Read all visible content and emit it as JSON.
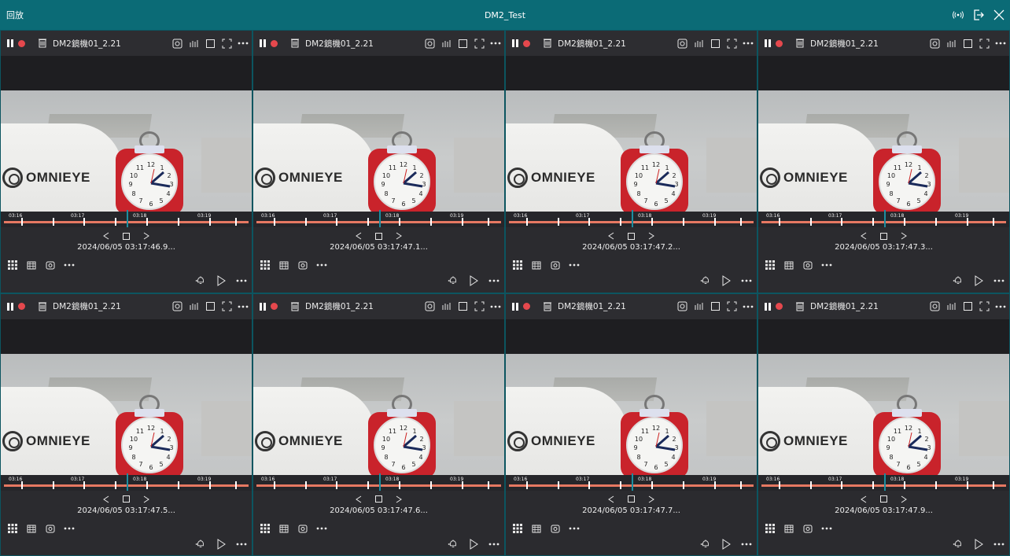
{
  "titlebar": {
    "app_title": "回放",
    "window_title": "DM2_Test",
    "icons": [
      "broadcast-icon",
      "exit-icon",
      "close-icon"
    ]
  },
  "panels": [
    {
      "camera": "DM2鏡機01_2.21",
      "timestamp": "2024/06/05 03:17:46.9..."
    },
    {
      "camera": "DM2鏡機01_2.21",
      "timestamp": "2024/06/05 03:17:47.1..."
    },
    {
      "camera": "DM2鏡機01_2.21",
      "timestamp": "2024/06/05 03:17:47.2..."
    },
    {
      "camera": "DM2鏡機01_2.21",
      "timestamp": "2024/06/05 03:17:47.3..."
    },
    {
      "camera": "DM2鏡機01_2.21",
      "timestamp": "2024/06/05 03:17:47.5..."
    },
    {
      "camera": "DM2鏡機01_2.21",
      "timestamp": "2024/06/05 03:17:47.6..."
    },
    {
      "camera": "DM2鏡機01_2.21",
      "timestamp": "2024/06/05 03:17:47.7..."
    },
    {
      "camera": "DM2鏡機01_2.21",
      "timestamp": "2024/06/05 03:17:47.9..."
    }
  ],
  "timeline": {
    "labels": [
      "03:16",
      "03:17",
      "03:18",
      "03:19"
    ]
  },
  "video_text": {
    "brand": "OMNIEYE"
  },
  "colors": {
    "titlebar": "#0b6b76",
    "panel_bg": "#2b2b2f",
    "record": "#e5484d",
    "timeline": "#e67862",
    "cursor": "#1c8ea0"
  }
}
